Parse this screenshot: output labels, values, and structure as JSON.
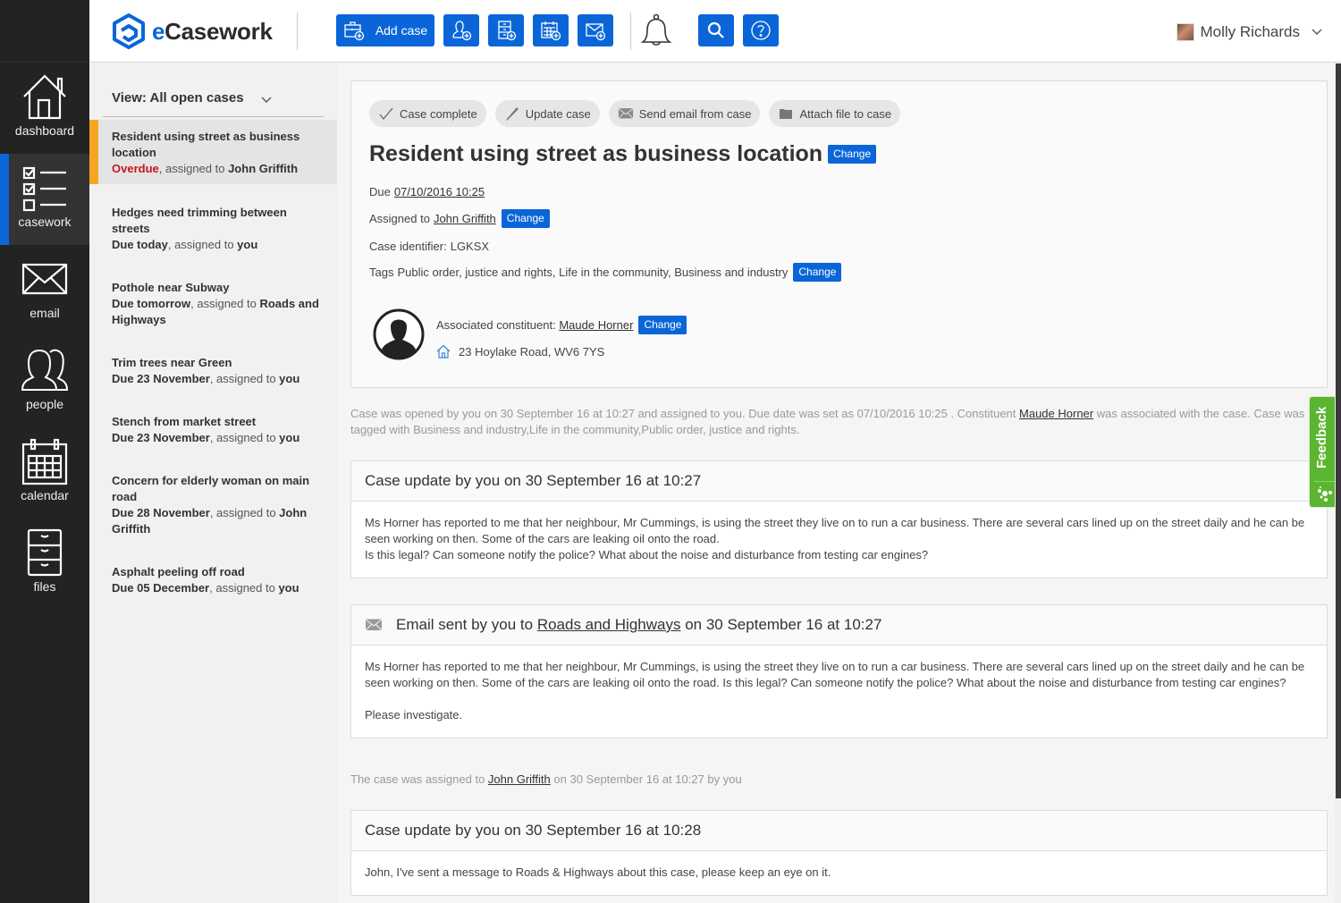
{
  "app": {
    "brand": {
      "prefix": "e",
      "name": "Casework"
    },
    "accent_color": "#0a66d8",
    "overdue_color": "#c8141e",
    "active_marker_color": "#f5a623",
    "feedback_color": "#5cb531"
  },
  "rail": {
    "items": [
      {
        "label": "dashboard",
        "icon": "house-icon"
      },
      {
        "label": "casework",
        "icon": "checklist-icon",
        "active": true
      },
      {
        "label": "email",
        "icon": "envelope-icon"
      },
      {
        "label": "people",
        "icon": "people-icon"
      },
      {
        "label": "calendar",
        "icon": "calendar-icon"
      },
      {
        "label": "files",
        "icon": "filing-cabinet-icon"
      }
    ]
  },
  "toolbar": {
    "add_case_label": "Add case",
    "buttons": [
      "add-case",
      "add-person",
      "add-file",
      "add-calendar-event",
      "compose-email"
    ],
    "notifications": "bell-icon",
    "search": "search-icon",
    "help": "help-icon"
  },
  "user": {
    "name": "Molly Richards"
  },
  "caselist": {
    "view_label": "View: All open cases",
    "cases": [
      {
        "title": "Resident using street as business location",
        "due": "Overdue",
        "assigned_prefix": ", assigned to ",
        "assignee": "John Griffith",
        "active": true
      },
      {
        "title": "Hedges need trimming between streets",
        "due": "Due today",
        "assigned_prefix": ", assigned to ",
        "assignee": "you"
      },
      {
        "title": "Pothole near Subway",
        "due": "Due tomorrow",
        "assigned_prefix": ", assigned to ",
        "assignee": "Roads and Highways"
      },
      {
        "title": "Trim trees near Green",
        "due": "Due 23 November",
        "assigned_prefix": ", assigned to ",
        "assignee": "you"
      },
      {
        "title": "Stench from market street",
        "due": "Due 23 November",
        "assigned_prefix": ", assigned to ",
        "assignee": "you"
      },
      {
        "title": "Concern for elderly woman on main road",
        "due": "Due 28 November",
        "assigned_prefix": ", assigned to ",
        "assignee": "John Griffith"
      },
      {
        "title": "Asphalt peeling off road",
        "due": "Due 05 December",
        "assigned_prefix": ", assigned to ",
        "assignee": "you"
      }
    ]
  },
  "case": {
    "actions": [
      {
        "label": "Case complete",
        "icon": "checkmark-icon"
      },
      {
        "label": "Update case",
        "icon": "pencil-icon"
      },
      {
        "label": "Send email from case",
        "icon": "envelope-icon"
      },
      {
        "label": "Attach file to case",
        "icon": "folder-icon"
      }
    ],
    "title": "Resident using street as business location",
    "change_label": "Change",
    "due_label": "Due",
    "due_value": "07/10/2016 10:25",
    "assigned_label": "Assigned to",
    "assigned_value": "John Griffith",
    "identifier_label": "Case identifier:",
    "identifier_value": "LGKSX",
    "tags_label": "Tags",
    "tags_value": "Public order, justice and rights, Life in the community, Business and industry",
    "constituent_label": "Associated constituent:",
    "constituent_name": "Maude Horner",
    "constituent_address": "23 Hoylake Road, WV6 7YS"
  },
  "history": {
    "opened_note": {
      "part1": "Case was opened by you on 30 September 16 at 10:27 and assigned to you. Due date was set as 07/10/2016 10:25 . Constituent ",
      "link": "Maude Horner",
      "part2": " was associated with the case. Case was tagged with Business and industry,Life in the community,Public order, justice and rights."
    },
    "update1": {
      "heading": "Case update by you on 30 September 16 at 10:27",
      "line1": "Ms Horner has reported to me that her neighbour, Mr Cummings, is using the street they live on to run a car business. There are several cars lined up on the street daily and he can be seen working on then. Some of the cars are leaking oil onto the road.",
      "line2": "Is this legal? Can someone notify the police? What about the noise and disturbance from testing car engines?"
    },
    "email1": {
      "heading_prefix": "Email sent by you to ",
      "heading_link": "Roads and Highways",
      "heading_suffix": " on 30 September 16 at 10:27",
      "body": "Ms Horner has reported to me that her neighbour, Mr Cummings, is using the street they live on to run a car business. There are several cars lined up on the street daily and he can be seen working on then. Some of the cars are leaking oil onto the road. Is this legal? Can someone notify the police? What about the noise and disturbance from testing car engines?",
      "closing": "Please investigate."
    },
    "assign_note": {
      "part1": "The case was assigned to ",
      "link": "John Griffith",
      "part2": " on 30 September 16 at 10:27 by you"
    },
    "update2": {
      "heading": "Case update by you on 30 September 16 at 10:28",
      "body": "John, I've sent a message to Roads & Highways about this case, please keep an eye on it."
    }
  },
  "feedback": {
    "label": "Feedback"
  }
}
